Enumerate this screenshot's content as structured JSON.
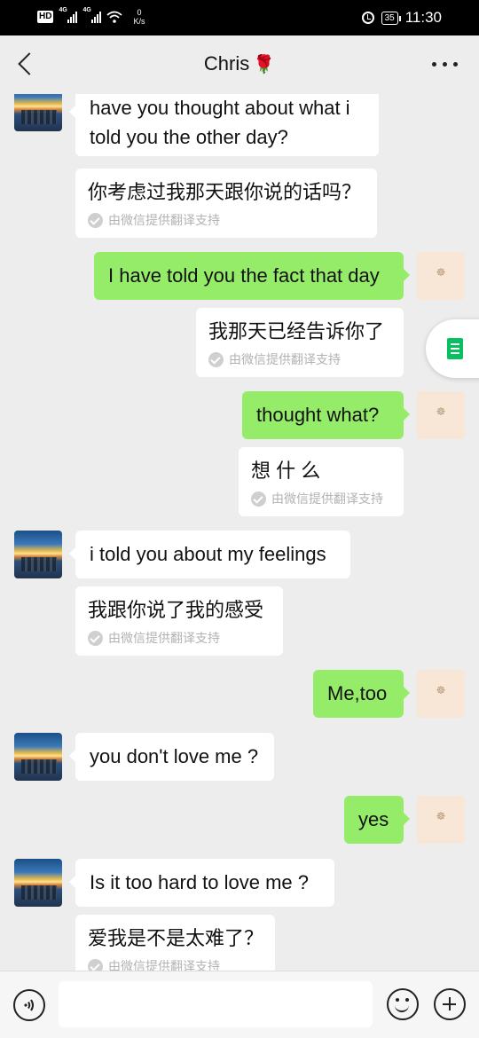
{
  "status_bar": {
    "hd_label": "HD",
    "network_1": "4G",
    "network_2": "4G",
    "net_speed_value": "0",
    "net_speed_unit": "K/s",
    "battery": "35",
    "time": "11:30"
  },
  "header": {
    "contact_name": "Chris",
    "contact_emoji": "🌹"
  },
  "messages": [
    {
      "from": "contact",
      "text": "have you thought about what i told you the other day?",
      "translation": "你考虑过我那天跟你说的话吗？",
      "translation_note": "由微信提供翻译支持"
    },
    {
      "from": "me",
      "text": "I have told you the fact that day",
      "translation": "我那天已经告诉你了",
      "translation_note": "由微信提供翻译支持"
    },
    {
      "from": "me",
      "text": "thought what?",
      "translation": "想 什 么",
      "translation_note": "由微信提供翻译支持"
    },
    {
      "from": "contact",
      "text": "i told you about my feelings",
      "translation": "我跟你说了我的感受",
      "translation_note": "由微信提供翻译支持"
    },
    {
      "from": "me",
      "text": "Me,too"
    },
    {
      "from": "contact",
      "text": "you don't love me ?"
    },
    {
      "from": "me",
      "text": "yes"
    },
    {
      "from": "contact",
      "text": "Is it too hard to love me ?",
      "translation": "爱我是不是太难了？",
      "translation_note": "由微信提供翻译支持"
    }
  ],
  "input_bar": {
    "input_value": ""
  },
  "colors": {
    "outgoing_bubble": "#95ec69",
    "incoming_bubble": "#ffffff",
    "background": "#ededed",
    "accent": "#07c160"
  }
}
